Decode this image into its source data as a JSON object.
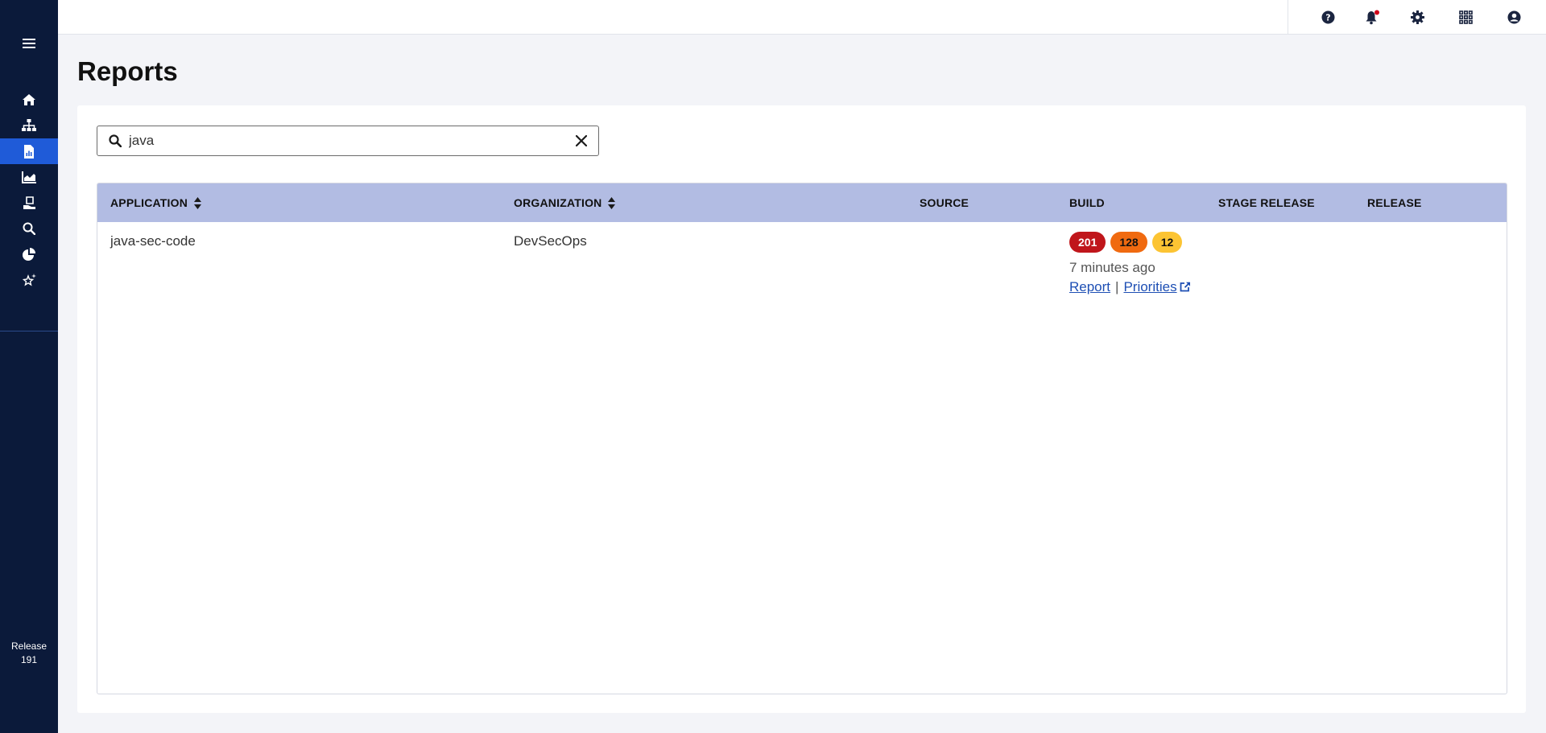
{
  "app": {
    "release_label": "Release",
    "release_number": "191"
  },
  "sidebar": {
    "items": [
      {
        "icon": "home-icon",
        "active": false
      },
      {
        "icon": "sitemap-icon",
        "active": false
      },
      {
        "icon": "report-file-icon",
        "active": true
      },
      {
        "icon": "area-chart-icon",
        "active": false
      },
      {
        "icon": "hand-receive-icon",
        "active": false
      },
      {
        "icon": "search-icon",
        "active": false
      },
      {
        "icon": "pie-chart-icon",
        "active": false
      },
      {
        "icon": "star-sparkle-icon",
        "active": false
      }
    ]
  },
  "topbar": {
    "icons": [
      "help-icon",
      "bell-icon",
      "gear-icon",
      "apps-grid-icon",
      "user-circle-icon"
    ],
    "notification_dot_color": "#d0021b"
  },
  "page": {
    "title": "Reports"
  },
  "search": {
    "value": "java",
    "placeholder": "Search"
  },
  "table": {
    "columns": [
      {
        "label": "APPLICATION",
        "sortable": true
      },
      {
        "label": "ORGANIZATION",
        "sortable": true
      },
      {
        "label": "SOURCE",
        "sortable": false
      },
      {
        "label": "BUILD",
        "sortable": false
      },
      {
        "label": "STAGE RELEASE",
        "sortable": false
      },
      {
        "label": "RELEASE",
        "sortable": false
      }
    ],
    "rows": [
      {
        "application": "java-sec-code",
        "organization": "DevSecOps",
        "source": "",
        "build": {
          "counts": {
            "critical": "201",
            "high": "128",
            "medium": "12"
          },
          "time": "7 minutes ago",
          "report_link": "Report",
          "separator": "|",
          "priorities_link": "Priorities"
        },
        "stage_release": "",
        "release": ""
      }
    ]
  },
  "colors": {
    "sidebar_bg": "#0b1a3a",
    "active_nav": "#1f5bd8",
    "table_header": "#b2bce3",
    "critical": "#c0161b",
    "high": "#f06a10",
    "medium": "#fcc433",
    "link": "#1e4fb4"
  }
}
